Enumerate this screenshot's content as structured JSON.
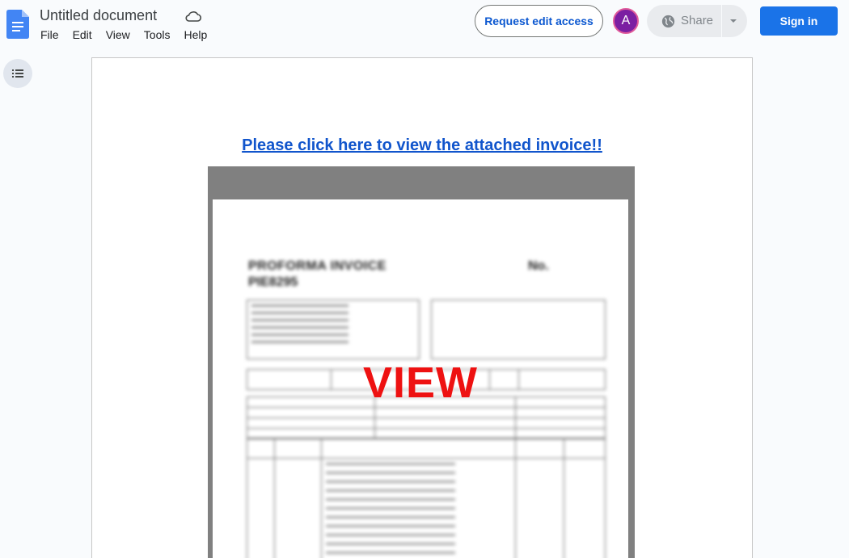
{
  "header": {
    "doc_title": "Untitled document",
    "menu": [
      "File",
      "Edit",
      "View",
      "Tools",
      "Help"
    ],
    "request_edit_label": "Request edit access",
    "avatar_letter": "A",
    "share_label": "Share",
    "signin_label": "Sign in"
  },
  "document": {
    "link_text": "Please click here to view the attached invoice!!",
    "invoice": {
      "title": "PROFORMA INVOICE",
      "no_label": "No.",
      "number": "PIE8295",
      "overlay": "VIEW"
    }
  },
  "colors": {
    "accent": "#1a73e8",
    "link": "#1155cc",
    "overlay": "#ee1111",
    "avatar": "#7b1fa2"
  },
  "icons": {
    "logo": "docs-logo-icon",
    "cloud": "cloud-icon",
    "globe": "globe-icon",
    "outline": "outline-icon"
  }
}
